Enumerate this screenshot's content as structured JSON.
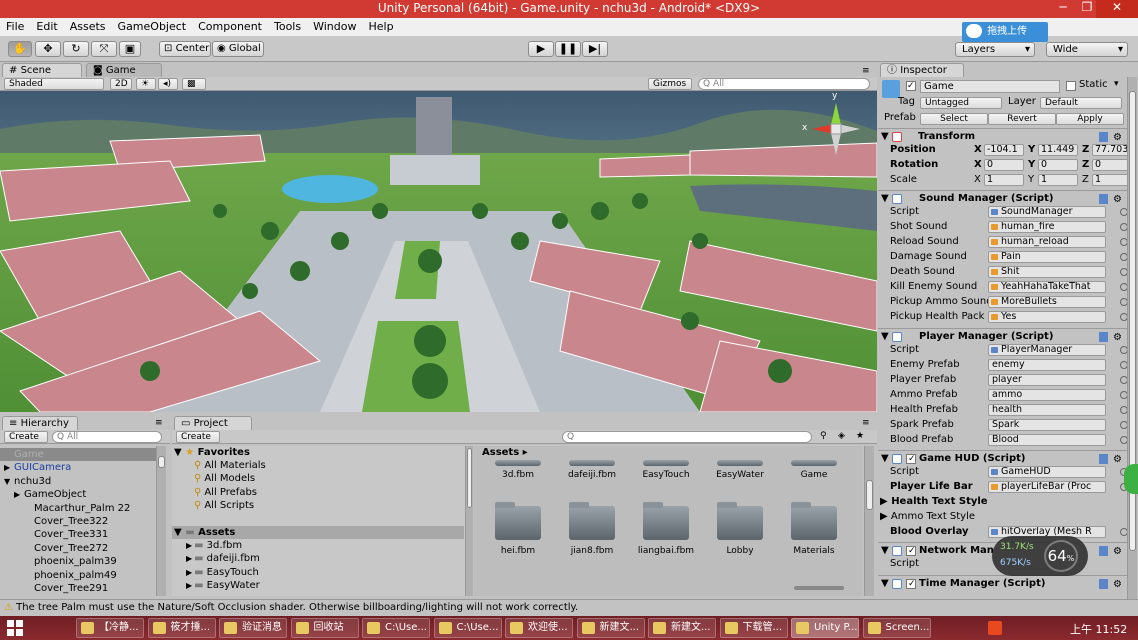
{
  "window": {
    "title": "Unity Personal (64bit) - Game.unity - nchu3d - Android* <DX9>",
    "minimize": "─",
    "maximize": "❐",
    "close": "✕"
  },
  "menu": [
    "File",
    "Edit",
    "Assets",
    "GameObject",
    "Component",
    "Tools",
    "Window",
    "Help"
  ],
  "toolbar": {
    "pivot": "Center",
    "space": "Global",
    "upload_label": "拖拽上传",
    "layers": "Layers",
    "layout": "Wide"
  },
  "scene": {
    "tab_scene": "Scene",
    "tab_game": "Game",
    "shading": "Shaded",
    "mode_2d": "2D",
    "gizmos": "Gizmos",
    "search_placeholder": "All",
    "gizmo_x": "x",
    "gizmo_y": "y"
  },
  "hierarchy": {
    "tab": "Hierarchy",
    "create": "Create",
    "search_placeholder": "All",
    "items": [
      {
        "label": "Game",
        "indent": 0,
        "expand": "",
        "selected": true,
        "color": "#b0b0b0"
      },
      {
        "label": "GUICamera",
        "indent": 0,
        "expand": "▶",
        "selected": false,
        "color": "#1a3fa0"
      },
      {
        "label": "nchu3d",
        "indent": 0,
        "expand": "▼",
        "selected": false,
        "color": "#000000"
      },
      {
        "label": "GameObject",
        "indent": 1,
        "expand": "▶",
        "selected": false,
        "color": "#000000"
      },
      {
        "label": "Macarthur_Palm 22",
        "indent": 2,
        "expand": "",
        "selected": false,
        "color": "#000000"
      },
      {
        "label": "Cover_Tree322",
        "indent": 2,
        "expand": "",
        "selected": false,
        "color": "#000000"
      },
      {
        "label": "Cover_Tree331",
        "indent": 2,
        "expand": "",
        "selected": false,
        "color": "#000000"
      },
      {
        "label": "Cover_Tree272",
        "indent": 2,
        "expand": "",
        "selected": false,
        "color": "#000000"
      },
      {
        "label": "phoenix_palm39",
        "indent": 2,
        "expand": "",
        "selected": false,
        "color": "#000000"
      },
      {
        "label": "phoenix_palm49",
        "indent": 2,
        "expand": "",
        "selected": false,
        "color": "#000000"
      },
      {
        "label": "Cover_Tree291",
        "indent": 2,
        "expand": "",
        "selected": false,
        "color": "#000000"
      }
    ]
  },
  "project": {
    "tab": "Project",
    "create": "Create",
    "favorites_title": "Favorites",
    "favorites": [
      "All Materials",
      "All Models",
      "All Prefabs",
      "All Scripts"
    ],
    "assets_title": "Assets",
    "assets_tree": [
      "3d.fbm",
      "dafeiji.fbm",
      "EasyTouch",
      "EasyWater"
    ],
    "breadcrumb": "Assets",
    "top_row": [
      "3d.fbm",
      "dafeiji.fbm",
      "EasyTouch",
      "EasyWater",
      "Game"
    ],
    "bottom_row": [
      "hei.fbm",
      "jian8.fbm",
      "liangbai.fbm",
      "Lobby",
      "Materials"
    ]
  },
  "inspector": {
    "tab": "Inspector",
    "object_name": "Game",
    "static_label": "Static",
    "tag_label": "Tag",
    "tag_value": "Untagged",
    "layer_label": "Layer",
    "layer_value": "Default",
    "prefab_label": "Prefab",
    "prefab_select": "Select",
    "prefab_revert": "Revert",
    "prefab_apply": "Apply",
    "transform": {
      "title": "Transform",
      "position_label": "Position",
      "rotation_label": "Rotation",
      "scale_label": "Scale",
      "position": [
        "-104.1",
        "11.449",
        "77.703"
      ],
      "rotation": [
        "0",
        "0",
        "0"
      ],
      "scale": [
        "1",
        "1",
        "1"
      ]
    },
    "sound_manager": {
      "title": "Sound Manager (Script)",
      "rows": [
        {
          "label": "Script",
          "value": "SoundManager",
          "kind": "script"
        },
        {
          "label": "Shot Sound",
          "value": "human_fire",
          "kind": "asset"
        },
        {
          "label": "Reload Sound",
          "value": "human_reload",
          "kind": "asset"
        },
        {
          "label": "Damage Sound",
          "value": "Pain",
          "kind": "asset"
        },
        {
          "label": "Death Sound",
          "value": "Shit",
          "kind": "asset"
        },
        {
          "label": "Kill Enemy Sound",
          "value": "YeahHahaTakeThat",
          "kind": "asset"
        },
        {
          "label": "Pickup Ammo Sound",
          "value": "MoreBullets",
          "kind": "asset"
        },
        {
          "label": "Pickup Health Pack S",
          "value": "Yes",
          "kind": "asset"
        }
      ]
    },
    "player_manager": {
      "title": "Player Manager (Script)",
      "rows": [
        {
          "label": "Script",
          "value": "PlayerManager",
          "kind": "script"
        },
        {
          "label": "Enemy Prefab",
          "value": "enemy",
          "kind": "plain"
        },
        {
          "label": "Player Prefab",
          "value": "player",
          "kind": "plain"
        },
        {
          "label": "Ammo Prefab",
          "value": "ammo",
          "kind": "plain"
        },
        {
          "label": "Health Prefab",
          "value": "health",
          "kind": "plain"
        },
        {
          "label": "Spark Prefab",
          "value": "Spark",
          "kind": "plain"
        },
        {
          "label": "Blood Prefab",
          "value": "Blood",
          "kind": "plain"
        }
      ]
    },
    "game_hud": {
      "title": "Game HUD (Script)",
      "script_label": "Script",
      "script_value": "GameHUD",
      "life_bar_label": "Player Life Bar",
      "life_bar_value": "playerLifeBar (Proc",
      "health_style": "Health Text Style",
      "ammo_style": "Ammo Text Style",
      "blood_label": "Blood Overlay",
      "blood_value": "hitOverlay (Mesh R"
    },
    "network_manager": {
      "title": "Network Man",
      "script_label": "Script"
    },
    "time_manager": {
      "title": "Time Manager (Script)"
    }
  },
  "overlay": {
    "upload_speed": "31.7K/s",
    "download_speed": "675K/s",
    "percent": "64",
    "percent_unit": "%"
  },
  "status": {
    "message": "The tree Palm must use the Nature/Soft Occlusion shader. Otherwise billboarding/lighting will not work correctly."
  },
  "taskbar": {
    "tasks": [
      "【冷静...",
      "筱才捶...",
      "验证消息",
      "回收站",
      "C:\\Use...",
      "C:\\Use...",
      "欢迎使...",
      "新建文...",
      "新建文...",
      "下载管...",
      "Unity P...",
      "Screen..."
    ],
    "active_index": 10,
    "clock": "上午 11:52"
  }
}
